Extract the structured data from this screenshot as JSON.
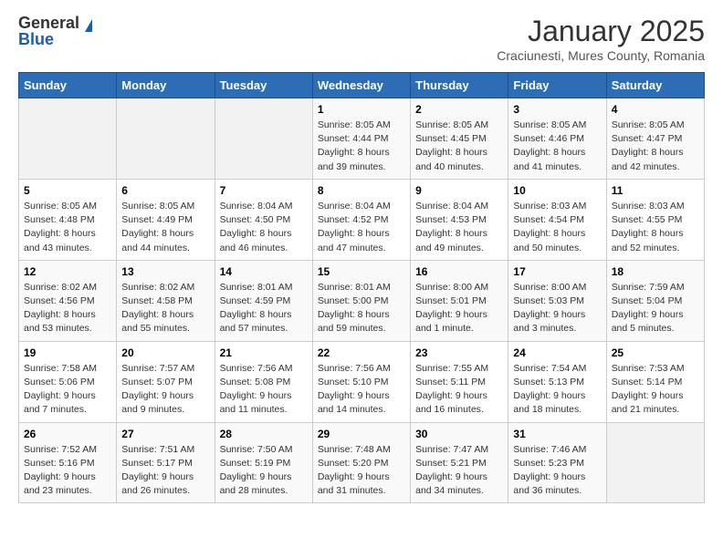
{
  "logo": {
    "general": "General",
    "blue": "Blue"
  },
  "title": "January 2025",
  "subtitle": "Craciunesti, Mures County, Romania",
  "headers": [
    "Sunday",
    "Monday",
    "Tuesday",
    "Wednesday",
    "Thursday",
    "Friday",
    "Saturday"
  ],
  "weeks": [
    [
      {
        "num": "",
        "info": ""
      },
      {
        "num": "",
        "info": ""
      },
      {
        "num": "",
        "info": ""
      },
      {
        "num": "1",
        "info": "Sunrise: 8:05 AM\nSunset: 4:44 PM\nDaylight: 8 hours\nand 39 minutes."
      },
      {
        "num": "2",
        "info": "Sunrise: 8:05 AM\nSunset: 4:45 PM\nDaylight: 8 hours\nand 40 minutes."
      },
      {
        "num": "3",
        "info": "Sunrise: 8:05 AM\nSunset: 4:46 PM\nDaylight: 8 hours\nand 41 minutes."
      },
      {
        "num": "4",
        "info": "Sunrise: 8:05 AM\nSunset: 4:47 PM\nDaylight: 8 hours\nand 42 minutes."
      }
    ],
    [
      {
        "num": "5",
        "info": "Sunrise: 8:05 AM\nSunset: 4:48 PM\nDaylight: 8 hours\nand 43 minutes."
      },
      {
        "num": "6",
        "info": "Sunrise: 8:05 AM\nSunset: 4:49 PM\nDaylight: 8 hours\nand 44 minutes."
      },
      {
        "num": "7",
        "info": "Sunrise: 8:04 AM\nSunset: 4:50 PM\nDaylight: 8 hours\nand 46 minutes."
      },
      {
        "num": "8",
        "info": "Sunrise: 8:04 AM\nSunset: 4:52 PM\nDaylight: 8 hours\nand 47 minutes."
      },
      {
        "num": "9",
        "info": "Sunrise: 8:04 AM\nSunset: 4:53 PM\nDaylight: 8 hours\nand 49 minutes."
      },
      {
        "num": "10",
        "info": "Sunrise: 8:03 AM\nSunset: 4:54 PM\nDaylight: 8 hours\nand 50 minutes."
      },
      {
        "num": "11",
        "info": "Sunrise: 8:03 AM\nSunset: 4:55 PM\nDaylight: 8 hours\nand 52 minutes."
      }
    ],
    [
      {
        "num": "12",
        "info": "Sunrise: 8:02 AM\nSunset: 4:56 PM\nDaylight: 8 hours\nand 53 minutes."
      },
      {
        "num": "13",
        "info": "Sunrise: 8:02 AM\nSunset: 4:58 PM\nDaylight: 8 hours\nand 55 minutes."
      },
      {
        "num": "14",
        "info": "Sunrise: 8:01 AM\nSunset: 4:59 PM\nDaylight: 8 hours\nand 57 minutes."
      },
      {
        "num": "15",
        "info": "Sunrise: 8:01 AM\nSunset: 5:00 PM\nDaylight: 8 hours\nand 59 minutes."
      },
      {
        "num": "16",
        "info": "Sunrise: 8:00 AM\nSunset: 5:01 PM\nDaylight: 9 hours\nand 1 minute."
      },
      {
        "num": "17",
        "info": "Sunrise: 8:00 AM\nSunset: 5:03 PM\nDaylight: 9 hours\nand 3 minutes."
      },
      {
        "num": "18",
        "info": "Sunrise: 7:59 AM\nSunset: 5:04 PM\nDaylight: 9 hours\nand 5 minutes."
      }
    ],
    [
      {
        "num": "19",
        "info": "Sunrise: 7:58 AM\nSunset: 5:06 PM\nDaylight: 9 hours\nand 7 minutes."
      },
      {
        "num": "20",
        "info": "Sunrise: 7:57 AM\nSunset: 5:07 PM\nDaylight: 9 hours\nand 9 minutes."
      },
      {
        "num": "21",
        "info": "Sunrise: 7:56 AM\nSunset: 5:08 PM\nDaylight: 9 hours\nand 11 minutes."
      },
      {
        "num": "22",
        "info": "Sunrise: 7:56 AM\nSunset: 5:10 PM\nDaylight: 9 hours\nand 14 minutes."
      },
      {
        "num": "23",
        "info": "Sunrise: 7:55 AM\nSunset: 5:11 PM\nDaylight: 9 hours\nand 16 minutes."
      },
      {
        "num": "24",
        "info": "Sunrise: 7:54 AM\nSunset: 5:13 PM\nDaylight: 9 hours\nand 18 minutes."
      },
      {
        "num": "25",
        "info": "Sunrise: 7:53 AM\nSunset: 5:14 PM\nDaylight: 9 hours\nand 21 minutes."
      }
    ],
    [
      {
        "num": "26",
        "info": "Sunrise: 7:52 AM\nSunset: 5:16 PM\nDaylight: 9 hours\nand 23 minutes."
      },
      {
        "num": "27",
        "info": "Sunrise: 7:51 AM\nSunset: 5:17 PM\nDaylight: 9 hours\nand 26 minutes."
      },
      {
        "num": "28",
        "info": "Sunrise: 7:50 AM\nSunset: 5:19 PM\nDaylight: 9 hours\nand 28 minutes."
      },
      {
        "num": "29",
        "info": "Sunrise: 7:48 AM\nSunset: 5:20 PM\nDaylight: 9 hours\nand 31 minutes."
      },
      {
        "num": "30",
        "info": "Sunrise: 7:47 AM\nSunset: 5:21 PM\nDaylight: 9 hours\nand 34 minutes."
      },
      {
        "num": "31",
        "info": "Sunrise: 7:46 AM\nSunset: 5:23 PM\nDaylight: 9 hours\nand 36 minutes."
      },
      {
        "num": "",
        "info": ""
      }
    ]
  ]
}
